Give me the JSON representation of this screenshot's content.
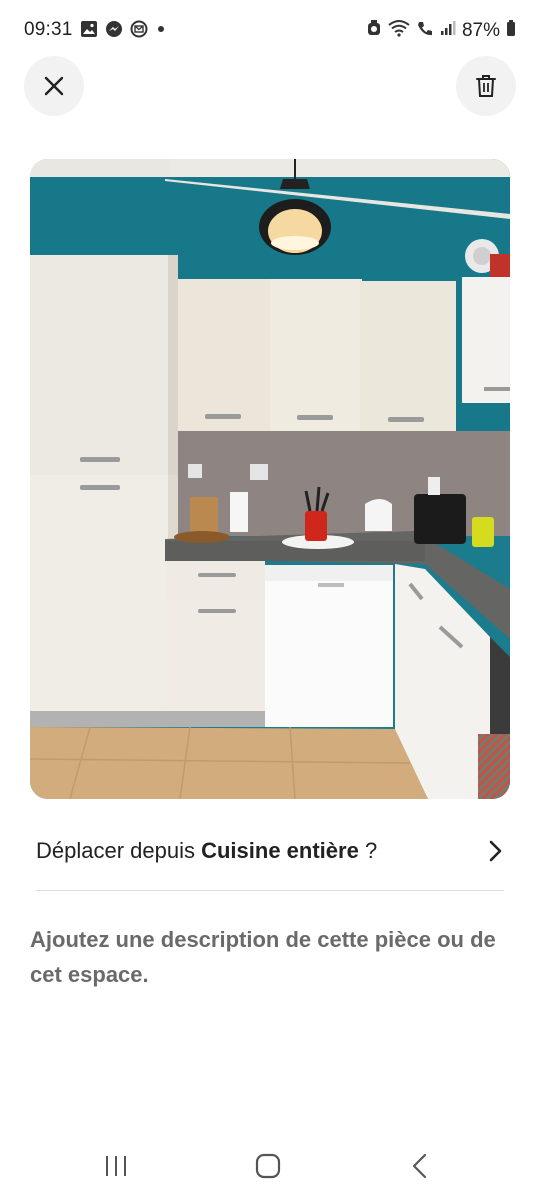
{
  "status": {
    "time": "09:31",
    "battery": "87%",
    "left_icons": [
      "gallery-icon",
      "messenger-icon",
      "mail-icon",
      "dot-icon"
    ],
    "right_icons": [
      "alarm-icon",
      "wifi-icon",
      "wifi-call-icon",
      "signal-icon",
      "battery-icon"
    ]
  },
  "toolbar": {
    "close_icon": "close-icon",
    "delete_icon": "trash-icon"
  },
  "photo": {
    "subject": "kitchen"
  },
  "move": {
    "prefix": "Déplacer depuis ",
    "room": "Cuisine entière",
    "suffix": " ?",
    "icon": "chevron-right-icon"
  },
  "description": {
    "placeholder": "Ajoutez une description de cette pièce ou de cet espace."
  },
  "nav": {
    "recent_icon": "recent-apps-icon",
    "home_icon": "home-icon",
    "back_icon": "back-icon"
  },
  "colors": {
    "wall": "#1a7c8c",
    "text_primary": "#222222",
    "text_secondary": "#6a6a6a",
    "button_bg": "#f2f2f2"
  }
}
